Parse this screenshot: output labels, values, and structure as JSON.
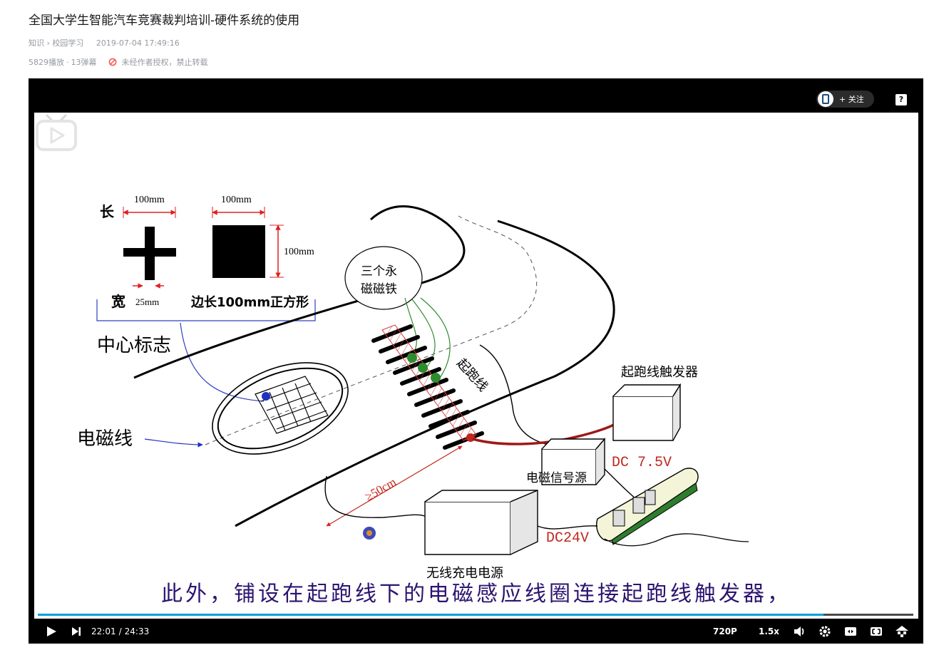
{
  "page": {
    "title": "全国大学生智能汽车竞赛裁判培训-硬件系统的使用",
    "breadcrumb": {
      "category": "知识",
      "separator": "›",
      "subcategory": "校园学习"
    },
    "date": "2019-07-04 17:49:16",
    "stats": {
      "plays": "5829播放",
      "dot": "·",
      "danmaku": "13弹幕"
    },
    "copyright_notice": "未经作者授权，禁止转载"
  },
  "player": {
    "follow_label": "+ 关注",
    "help_label": "?",
    "subtitle": "此外，铺设在起跑线下的电磁感应线圈连接起跑线触发器，",
    "current_time": "22:01",
    "time_separator": "/",
    "duration": "24:33",
    "progress_fraction": 0.897,
    "quality": "720P",
    "speed": "1.5x"
  },
  "diagram": {
    "label_long": "长",
    "label_wide": "宽",
    "dim_cross_width": "100mm",
    "dim_square_width": "100mm",
    "dim_square_height": "100mm",
    "dim_cross_bar": "25mm",
    "square_caption": "边长100mm正方形",
    "center_mark": "中心标志",
    "em_line": "电磁线",
    "magnets_line1": "三个永",
    "magnets_line2": "磁磁铁",
    "start_line": "起跑线",
    "distance": "≥50cm",
    "trigger": "起跑线触发器",
    "signal_source": "电磁信号源",
    "dc_75": "DC 7.5V",
    "dc_24": "DC24V",
    "wireless_power": "无线充电电源"
  },
  "colors": {
    "accent": "#00a1d6",
    "subtitle": "#2c1470",
    "dimension": "#e02020",
    "dc_label": "#c0281e",
    "magnet": "#2e8b2e"
  }
}
